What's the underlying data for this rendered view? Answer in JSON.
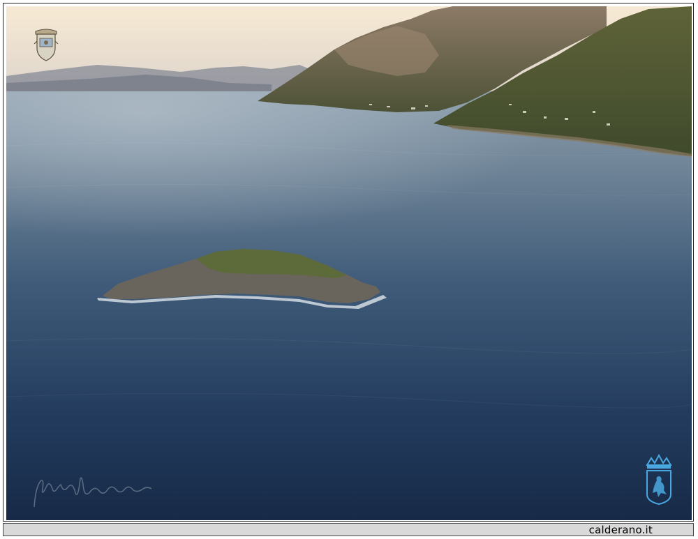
{
  "footer": {
    "site_label": "calderano.it"
  },
  "colors": {
    "sky_top": "#f7e9d2",
    "sky_bottom": "#d8cfc8",
    "sea_far": "#7f93a3",
    "sea_mid": "#3d5a78",
    "sea_near": "#1a2f4e",
    "hills_distant": "#8a8e99",
    "mountain": "#6e6656",
    "hillside_green": "#4f5a33",
    "island_rock": "#6a655c",
    "island_grass": "#5d6b3a",
    "crest_bottom": "#4aa8e0",
    "footer_bg": "#d9d9d9"
  },
  "icons": {
    "top_left": "coat-of-arms-icon",
    "bottom_right": "crowned-lion-crest-icon",
    "bottom_left": "signature-mark"
  }
}
